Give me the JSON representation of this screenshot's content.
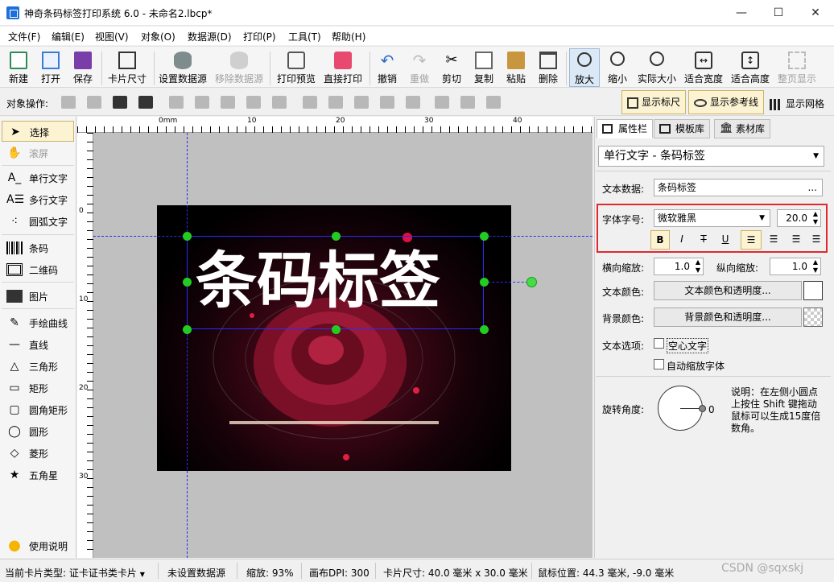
{
  "window": {
    "title": "神奇条码标签打印系统 6.0 - 未命名2.lbcp*",
    "minimize": "—",
    "maximize": "☐",
    "close": "✕"
  },
  "menu": [
    "文件(F)",
    "编辑(E)",
    "视图(V)",
    "对象(O)",
    "数据源(D)",
    "打印(P)",
    "工具(T)",
    "帮助(H)"
  ],
  "toolbar": {
    "new": "新建",
    "open": "打开",
    "save": "保存",
    "card_size": "卡片尺寸",
    "set_datasource": "设置数据源",
    "remove_datasource": "移除数据源",
    "print_preview": "打印预览",
    "direct_print": "直接打印",
    "undo": "撤销",
    "redo": "重做",
    "cut": "剪切",
    "copy": "复制",
    "paste": "粘贴",
    "delete": "删除",
    "zoom_in": "放大",
    "zoom_out": "缩小",
    "actual_size": "实际大小",
    "fit_width": "适合宽度",
    "fit_height": "适合高度",
    "full_page": "整页显示"
  },
  "opsbar": {
    "label": "对象操作:",
    "show_ruler": "显示标尺",
    "show_guides": "显示参考线",
    "show_grid": "显示网格"
  },
  "palette": [
    "选择",
    "滚屏",
    "单行文字",
    "多行文字",
    "圆弧文字",
    "条码",
    "二维码",
    "图片",
    "手绘曲线",
    "直线",
    "三角形",
    "矩形",
    "圆角矩形",
    "圆形",
    "菱形",
    "五角星",
    "使用说明"
  ],
  "ruler": {
    "unit": "mm",
    "h_labels": [
      "0",
      "10",
      "20",
      "30",
      "40"
    ],
    "v_labels": [
      "0",
      "10",
      "20",
      "30"
    ]
  },
  "canvas": {
    "text": "条码标签"
  },
  "panel": {
    "tabs": [
      "属性栏",
      "模板库",
      "素材库"
    ],
    "object_type": "单行文字 - 条码标签",
    "text_data_label": "文本数据:",
    "text_data_value": "条码标签",
    "text_data_btn": "...",
    "font_label": "字体字号:",
    "font_name": "微软雅黑",
    "font_size": "20.0",
    "bold": "B",
    "italic": "I",
    "strike": "T",
    "underline": "U",
    "hscale_label": "横向缩放:",
    "hscale": "1.0",
    "vscale_label": "纵向缩放:",
    "vscale": "1.0",
    "text_color_label": "文本颜色:",
    "text_color_btn": "文本颜色和透明度...",
    "bg_color_label": "背景颜色:",
    "bg_color_btn": "背景颜色和透明度...",
    "text_options_label": "文本选项:",
    "hollow_text": "空心文字",
    "auto_shrink": "自动缩放字体",
    "rotation_label": "旋转角度:",
    "rotation_value": "0",
    "rotation_note": "说明：在左侧小圆点上按住 Shift 键拖动鼠标可以生成15度倍数角。"
  },
  "status": {
    "card_type": "当前卡片类型: 证卡证书类卡片",
    "datasource": "未设置数据源",
    "zoom": "缩放: 93%",
    "dpi": "画布DPI: 300",
    "card_size": "卡片尺寸: 40.0 毫米 x 30.0 毫米",
    "mouse": "鼠标位置: 44.3 毫米, -9.0 毫米",
    "watermark": "CSDN @sqxskj"
  },
  "colors": {
    "highlight_border": "#e0282e",
    "handle": "#22cc22",
    "guide": "#2a2aff",
    "accent": "#1e6fd9"
  }
}
